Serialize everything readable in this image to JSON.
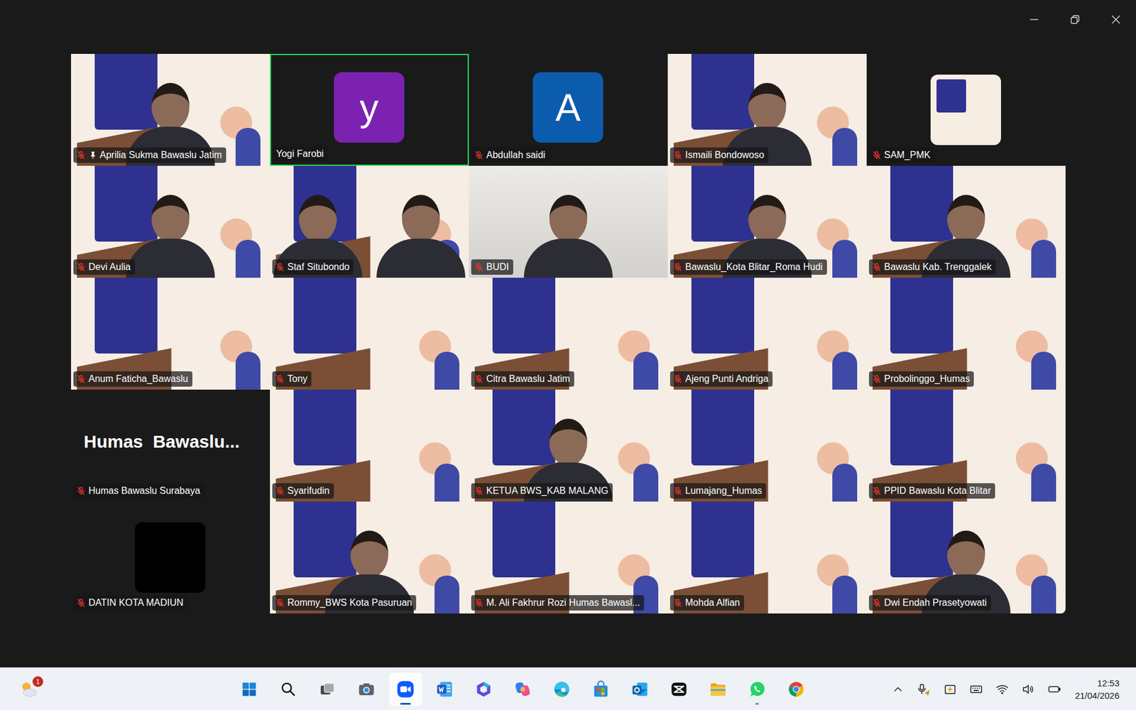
{
  "gallery": {
    "tiles": [
      {
        "name": "Aprilia Sukma Bawaslu Jatim",
        "kind": "video",
        "people": 1,
        "muted": true,
        "pinned": true,
        "speaking": false
      },
      {
        "name": "Yogi Farobi",
        "kind": "avatar",
        "initial": "y",
        "color": "#7b22b0",
        "muted": false,
        "pinned": false,
        "speaking": true
      },
      {
        "name": "Abdullah saidi",
        "kind": "avatar",
        "initial": "A",
        "color": "#0b5cad",
        "muted": true,
        "pinned": false,
        "speaking": false
      },
      {
        "name": "Ismaili Bondowoso",
        "kind": "video",
        "people": 1,
        "muted": true,
        "pinned": false,
        "speaking": false
      },
      {
        "name": "SAM_PMK",
        "kind": "picture",
        "color": "#f6ede3",
        "muted": true,
        "pinned": false,
        "speaking": false
      },
      {
        "name": "Devi Aulia",
        "kind": "video",
        "people": 1,
        "muted": true,
        "pinned": false,
        "speaking": false
      },
      {
        "name": "Staf Situbondo",
        "kind": "video",
        "people": 2,
        "muted": true,
        "pinned": false,
        "speaking": false
      },
      {
        "name": "BUDI",
        "kind": "camera",
        "people": 1,
        "muted": true,
        "pinned": false,
        "speaking": false
      },
      {
        "name": "Bawaslu_Kota Blitar_Roma Hudi",
        "kind": "video",
        "people": 1,
        "muted": true,
        "pinned": false,
        "speaking": false
      },
      {
        "name": "Bawaslu Kab. Trenggalek",
        "kind": "video",
        "people": 1,
        "muted": true,
        "pinned": false,
        "speaking": false
      },
      {
        "name": "Anum Faticha_Bawaslu",
        "kind": "video",
        "people": 0,
        "muted": true,
        "pinned": false,
        "speaking": false
      },
      {
        "name": "Tony",
        "kind": "video",
        "people": 0,
        "muted": true,
        "pinned": false,
        "speaking": false
      },
      {
        "name": "Citra Bawaslu Jatim",
        "kind": "video",
        "people": 0,
        "muted": true,
        "pinned": false,
        "speaking": false
      },
      {
        "name": "Ajeng Punti Andriga",
        "kind": "video",
        "people": 0,
        "muted": true,
        "pinned": false,
        "speaking": false
      },
      {
        "name": "Probolinggo_Humas",
        "kind": "video",
        "people": 0,
        "muted": true,
        "pinned": false,
        "speaking": false
      },
      {
        "name": "Humas Bawaslu Surabaya",
        "kind": "text",
        "display": "Humas  Bawaslu...",
        "muted": true,
        "pinned": false,
        "speaking": false
      },
      {
        "name": "Syarifudin",
        "kind": "video",
        "people": 0,
        "muted": true,
        "pinned": false,
        "speaking": false
      },
      {
        "name": "KETUA BWS_KAB MALANG",
        "kind": "video",
        "people": 1,
        "muted": true,
        "pinned": false,
        "speaking": false
      },
      {
        "name": "Lumajang_Humas",
        "kind": "video",
        "people": 0,
        "muted": true,
        "pinned": false,
        "speaking": false
      },
      {
        "name": "PPID Bawaslu Kota Blitar",
        "kind": "video",
        "people": 0,
        "muted": true,
        "pinned": false,
        "speaking": false
      },
      {
        "name": "DATIN KOTA MADIUN",
        "kind": "picture",
        "color": "#000000",
        "muted": true,
        "pinned": false,
        "speaking": false
      },
      {
        "name": "Rommy_BWS Kota Pasuruan",
        "kind": "video",
        "people": 1,
        "muted": true,
        "pinned": false,
        "speaking": false
      },
      {
        "name": "M. Ali Fakhrur Rozi Humas Bawasl...",
        "kind": "video",
        "people": 0,
        "muted": true,
        "pinned": false,
        "speaking": false
      },
      {
        "name": "Mohda Alfian",
        "kind": "video",
        "people": 0,
        "muted": true,
        "pinned": false,
        "speaking": false
      },
      {
        "name": "Dwi Endah Prasetyowati",
        "kind": "video",
        "people": 1,
        "muted": true,
        "pinned": false,
        "speaking": false
      }
    ]
  },
  "taskbar": {
    "weather": {
      "badge": "1"
    },
    "apps": [
      {
        "kind": "start",
        "focused": false,
        "running": false
      },
      {
        "kind": "search",
        "focused": false,
        "running": false
      },
      {
        "kind": "taskview",
        "focused": false,
        "running": false
      },
      {
        "kind": "camera",
        "focused": false,
        "running": false
      },
      {
        "kind": "zoom",
        "focused": true,
        "running": true
      },
      {
        "kind": "word",
        "focused": false,
        "running": false
      },
      {
        "kind": "copilot-app",
        "focused": false,
        "running": false
      },
      {
        "kind": "copilot",
        "focused": false,
        "running": false
      },
      {
        "kind": "edge",
        "focused": false,
        "running": false
      },
      {
        "kind": "store",
        "focused": false,
        "running": false
      },
      {
        "kind": "outlook",
        "focused": false,
        "running": false
      },
      {
        "kind": "capcut",
        "focused": false,
        "running": false
      },
      {
        "kind": "files",
        "focused": false,
        "running": false
      },
      {
        "kind": "whatsapp",
        "focused": false,
        "running": true
      },
      {
        "kind": "chrome",
        "focused": false,
        "running": false
      }
    ],
    "tray": [
      {
        "kind": "chevron"
      },
      {
        "kind": "mic"
      },
      {
        "kind": "copilot-key"
      },
      {
        "kind": "keyboard"
      },
      {
        "kind": "wifi"
      },
      {
        "kind": "volume"
      },
      {
        "kind": "battery"
      }
    ],
    "clock": {
      "time": "12:53",
      "date": "21/04/2026"
    }
  }
}
